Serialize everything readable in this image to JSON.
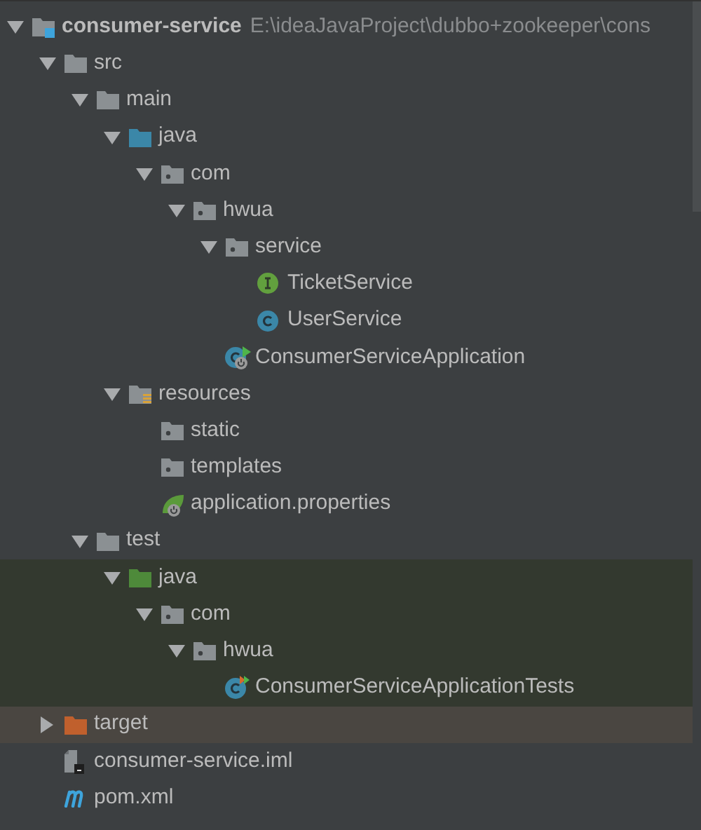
{
  "tree": [
    {
      "kind": "module",
      "label": "consumer-service",
      "path": "E:\\ideaJavaProject\\dubbo+zookeeper\\cons",
      "expanded": true,
      "test_scope": false,
      "excluded": false,
      "children": [
        {
          "kind": "folder",
          "label": "src",
          "expanded": true,
          "test_scope": false,
          "excluded": false,
          "children": [
            {
              "kind": "folder",
              "label": "main",
              "expanded": true,
              "test_scope": false,
              "excluded": false,
              "children": [
                {
                  "kind": "source-folder",
                  "label": "java",
                  "expanded": true,
                  "test_scope": false,
                  "excluded": false,
                  "children": [
                    {
                      "kind": "package",
                      "label": "com",
                      "expanded": true,
                      "test_scope": false,
                      "excluded": false,
                      "children": [
                        {
                          "kind": "package",
                          "label": "hwua",
                          "expanded": true,
                          "test_scope": false,
                          "excluded": false,
                          "children": [
                            {
                              "kind": "package",
                              "label": "service",
                              "expanded": true,
                              "test_scope": false,
                              "excluded": false,
                              "children": [
                                {
                                  "kind": "interface",
                                  "label": "TicketService",
                                  "test_scope": false,
                                  "excluded": false
                                },
                                {
                                  "kind": "class",
                                  "label": "UserService",
                                  "test_scope": false,
                                  "excluded": false
                                }
                              ]
                            },
                            {
                              "kind": "spring-app",
                              "label": "ConsumerServiceApplication",
                              "test_scope": false,
                              "excluded": false
                            }
                          ]
                        }
                      ]
                    }
                  ]
                },
                {
                  "kind": "resources-folder",
                  "label": "resources",
                  "expanded": true,
                  "test_scope": false,
                  "excluded": false,
                  "children": [
                    {
                      "kind": "package",
                      "label": "static",
                      "test_scope": false,
                      "excluded": false
                    },
                    {
                      "kind": "package",
                      "label": "templates",
                      "test_scope": false,
                      "excluded": false
                    },
                    {
                      "kind": "properties",
                      "label": "application.properties",
                      "test_scope": false,
                      "excluded": false
                    }
                  ]
                }
              ]
            },
            {
              "kind": "folder",
              "label": "test",
              "expanded": true,
              "test_scope": false,
              "excluded": false,
              "children": [
                {
                  "kind": "test-folder",
                  "label": "java",
                  "expanded": true,
                  "test_scope": true,
                  "excluded": false,
                  "children": [
                    {
                      "kind": "package",
                      "label": "com",
                      "expanded": true,
                      "test_scope": true,
                      "excluded": false,
                      "children": [
                        {
                          "kind": "package",
                          "label": "hwua",
                          "expanded": true,
                          "test_scope": true,
                          "excluded": false,
                          "children": [
                            {
                              "kind": "test-class",
                              "label": "ConsumerServiceApplicationTests",
                              "test_scope": true,
                              "excluded": false
                            }
                          ]
                        }
                      ]
                    }
                  ]
                }
              ]
            }
          ]
        },
        {
          "kind": "excluded-folder",
          "label": "target",
          "expanded": false,
          "test_scope": false,
          "excluded": true
        },
        {
          "kind": "iml",
          "label": "consumer-service.iml",
          "test_scope": false,
          "excluded": false
        },
        {
          "kind": "maven",
          "label": "pom.xml",
          "test_scope": false,
          "excluded": false
        }
      ]
    }
  ]
}
